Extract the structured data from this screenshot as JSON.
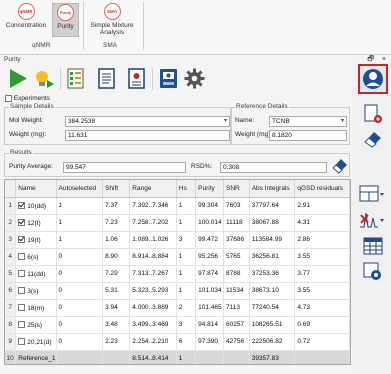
{
  "ribbon": {
    "items": [
      {
        "icon_text": "qNMR",
        "label": "Concentration"
      },
      {
        "icon_text": "Purity",
        "label": "Purity"
      },
      {
        "icon_text": "SMA",
        "label": "Simple Mixture\nAnalysis"
      }
    ],
    "groups": [
      "qNMR",
      "SMA"
    ]
  },
  "panel": {
    "title": "Purity",
    "pin": "ᑊ",
    "close": "×"
  },
  "toolbar": {
    "icons": [
      "play-icon",
      "lightbulb-icon",
      "checklist-icon",
      "document-icon",
      "report-icon",
      "save-book-icon",
      "gear-icon"
    ]
  },
  "sidebar": {
    "icons": [
      "person-icon",
      "add-document-icon",
      "eraser-icon",
      "layout-icon",
      "peak-pick-icon",
      "table-icon",
      "zoom-settings-icon"
    ]
  },
  "form": {
    "experiments_label": "Experiments",
    "sample": {
      "legend": "Sample Details",
      "mol_weight_label": "Mol Weight:",
      "mol_weight_value": "384.2538",
      "weight_label": "Weight (mg):",
      "weight_value": "11.631"
    },
    "reference": {
      "legend": "Reference Details",
      "name_label": "Name:",
      "name_value": "TCNB",
      "weight_label": "Weight (mg):",
      "weight_value": "8.1820"
    },
    "results": {
      "legend": "Results",
      "purity_label": "Purity Average:",
      "purity_value": "99.547",
      "rsd_label": "RSD%:",
      "rsd_value": "0.308"
    }
  },
  "grid": {
    "columns": [
      "",
      "Name",
      "Autoselected",
      "Shift",
      "Range",
      "Hs",
      "Purity",
      "SNR",
      "Abs Integrals",
      "qGSD residuals"
    ],
    "rows": [
      {
        "n": "1",
        "checked": true,
        "name": "10(dd)",
        "auto": "1",
        "shift": "7.37",
        "range": "7.392..7.346",
        "hs": "1",
        "purity": "99.304",
        "snr": "7603",
        "abs": "37797.64",
        "qgsd": "2.91"
      },
      {
        "n": "2",
        "checked": true,
        "name": "12(t)",
        "auto": "1",
        "shift": "7.23",
        "range": "7.258..7.202",
        "hs": "1",
        "purity": "100.014",
        "snr": "11118",
        "abs": "38067.88",
        "qgsd": "4.31"
      },
      {
        "n": "3",
        "checked": true,
        "name": "19(t)",
        "auto": "1",
        "shift": "1.06",
        "range": "1.089..1.026",
        "hs": "3",
        "purity": "99.472",
        "snr": "37686",
        "abs": "113584.99",
        "qgsd": "2.86"
      },
      {
        "n": "4",
        "checked": false,
        "name": "6(s)",
        "auto": "0",
        "shift": "8.90",
        "range": "8.914..8.884",
        "hs": "1",
        "purity": "95.256",
        "snr": "5765",
        "abs": "36256.81",
        "qgsd": "3.55"
      },
      {
        "n": "5",
        "checked": false,
        "name": "11(dd)",
        "auto": "0",
        "shift": "7.29",
        "range": "7.313..7.267",
        "hs": "1",
        "purity": "97.874",
        "snr": "8788",
        "abs": "37253.36",
        "qgsd": "3.77"
      },
      {
        "n": "6",
        "checked": false,
        "name": "3(s)",
        "auto": "0",
        "shift": "5.31",
        "range": "5.323..5.293",
        "hs": "1",
        "purity": "101.034",
        "snr": "11534",
        "abs": "38673.10",
        "qgsd": "3.55"
      },
      {
        "n": "7",
        "checked": false,
        "name": "18(m)",
        "auto": "0",
        "shift": "3.94",
        "range": "4.000..3.889",
        "hs": "2",
        "purity": "101.465",
        "snr": "7113",
        "abs": "77240.54",
        "qgsd": "4.73"
      },
      {
        "n": "8",
        "checked": false,
        "name": "25(s)",
        "auto": "0",
        "shift": "3.48",
        "range": "3.499..3.469",
        "hs": "3",
        "purity": "94.814",
        "snr": "60257",
        "abs": "108265.51",
        "qgsd": "0.69"
      },
      {
        "n": "9",
        "checked": false,
        "name": "20,21(d)",
        "auto": "0",
        "shift": "2.23",
        "range": "2.254..2.210",
        "hs": "6",
        "purity": "97.390",
        "snr": "42756",
        "abs": "222506.82",
        "qgsd": "0.72"
      }
    ],
    "reference_row": {
      "n": "10",
      "name": "Reference_1",
      "range": "8.514..8.414",
      "hs": "1",
      "abs": "39357.83"
    }
  },
  "colors": {
    "accent_red": "#c0272d",
    "play_green": "#2e9c2e",
    "selected_ribbon": "#cfcfcf",
    "sidebar_active_border": "#c0272d"
  }
}
